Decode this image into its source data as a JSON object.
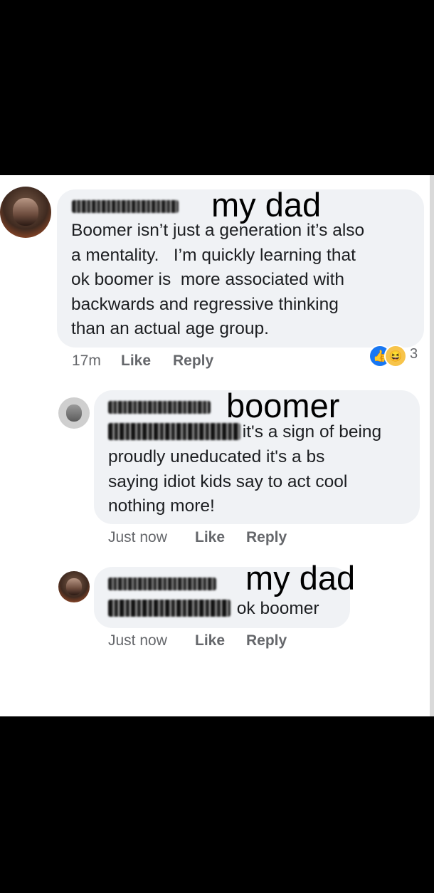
{
  "comments": [
    {
      "annotation": "my dad",
      "text": "Boomer isn’t just a generation it’s also\na mentality.   I’m quickly learning that\nok boomer is  more associated with\nbackwards and regressive thinking\nthan an actual age group.",
      "time": "17m",
      "like_label": "Like",
      "reply_label": "Reply",
      "reactions": {
        "count": "3",
        "like_icon": "thumbs-up-icon",
        "haha_icon": "laughing-face-icon"
      }
    },
    {
      "annotation": "boomer",
      "text_first_line": " it's a sign of being",
      "text_rest": "proudly uneducated it's a bs\nsaying idiot kids say to act cool\nnothing more!",
      "time": "Just now",
      "like_label": "Like",
      "reply_label": "Reply"
    },
    {
      "annotation": "my dad",
      "text": " ok boomer",
      "time": "Just now",
      "like_label": "Like",
      "reply_label": "Reply"
    }
  ],
  "colors": {
    "bubble": "#f0f2f5",
    "meta_text": "#65676b",
    "like_blue": "#1877f2",
    "haha_yellow": "#f7c44a"
  }
}
